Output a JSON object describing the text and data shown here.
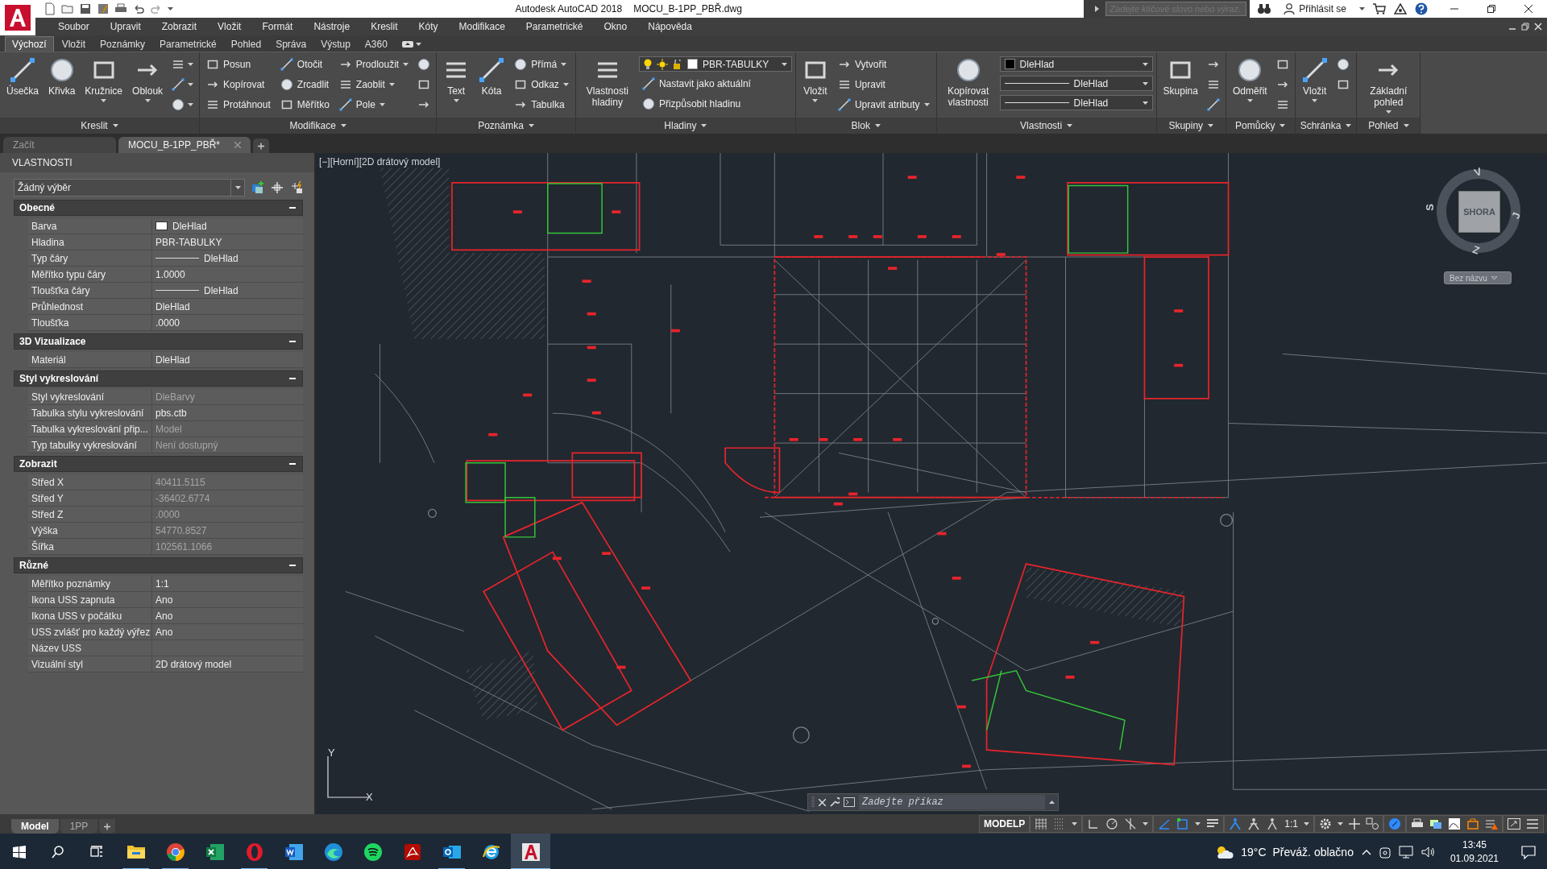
{
  "title_bar": {
    "app_title": "Autodesk AutoCAD 2018",
    "file_name": "MOCU_B-1PP_PBŘ.dwg",
    "search": {
      "placeholder": "Zadejte klíčové slovo nebo výraz."
    },
    "sign_in": "Přihlásit se"
  },
  "menu": [
    "Soubor",
    "Upravit",
    "Zobrazit",
    "Vložit",
    "Formát",
    "Nástroje",
    "Kreslit",
    "Kóty",
    "Modifikace",
    "Parametrické",
    "Okno",
    "Nápověda"
  ],
  "ribbon_tabs": [
    {
      "label": "Výchozí",
      "selected": true
    },
    {
      "label": "Vložit",
      "selected": false
    },
    {
      "label": "Poznámky",
      "selected": false
    },
    {
      "label": "Parametrické",
      "selected": false
    },
    {
      "label": "Pohled",
      "selected": false
    },
    {
      "label": "Správa",
      "selected": false
    },
    {
      "label": "Výstup",
      "selected": false
    },
    {
      "label": "A360",
      "selected": false
    }
  ],
  "ribbon_panels": [
    {
      "title": "Kreslit",
      "columns": [
        [
          {
            "kind": "large",
            "label": "Úsečka",
            "menu": false
          }
        ],
        [
          {
            "kind": "large",
            "label": "Křivka",
            "menu": false
          }
        ],
        [
          {
            "kind": "large",
            "label": "Kružnice",
            "menu": true
          }
        ],
        [
          {
            "kind": "large",
            "label": "Oblouk",
            "menu": true
          }
        ],
        [
          {
            "kind": "icon",
            "menu": true
          },
          {
            "kind": "icon",
            "menu": true
          },
          {
            "kind": "icon",
            "menu": true
          }
        ]
      ]
    },
    {
      "title": "Modifikace",
      "columns": [
        [
          {
            "kind": "small",
            "label": "Posun",
            "menu": false
          },
          {
            "kind": "small",
            "label": "Kopírovat",
            "menu": false
          },
          {
            "kind": "small",
            "label": "Protáhnout",
            "menu": false
          }
        ],
        [
          {
            "kind": "small",
            "label": "Otočit",
            "menu": false
          },
          {
            "kind": "small",
            "label": "Zrcadlit",
            "menu": false
          },
          {
            "kind": "small",
            "label": "Měřítko",
            "menu": false
          }
        ],
        [
          {
            "kind": "small",
            "label": "Prodloužit",
            "menu": true
          },
          {
            "kind": "small",
            "label": "Zaoblit",
            "menu": true
          },
          {
            "kind": "small",
            "label": "Pole",
            "menu": true
          }
        ],
        [
          {
            "kind": "icon",
            "menu": false
          },
          {
            "kind": "icon",
            "menu": false
          },
          {
            "kind": "icon",
            "menu": false
          }
        ]
      ]
    },
    {
      "title": "Poznámka",
      "columns": [
        [
          {
            "kind": "large",
            "label": "Text",
            "menu": true
          }
        ],
        [
          {
            "kind": "large",
            "label": "Kóta",
            "menu": false
          }
        ],
        [
          {
            "kind": "small",
            "label": "Přímá",
            "menu": true
          },
          {
            "kind": "small",
            "label": "Odkaz",
            "menu": true
          },
          {
            "kind": "small",
            "label": "Tabulka",
            "menu": false
          }
        ]
      ]
    },
    {
      "title": "Hladiny",
      "columns": [
        [
          {
            "kind": "large",
            "label": "Vlastnosti hladiny",
            "menu": false
          }
        ],
        [
          {
            "kind": "layer-dropdown",
            "value": "PBR-TABULKY"
          },
          {
            "kind": "small",
            "label": "Nastavit jako aktuální",
            "menu": false
          },
          {
            "kind": "small",
            "label": "Přizpůsobit hladinu",
            "menu": false
          }
        ]
      ]
    },
    {
      "title": "Blok",
      "columns": [
        [
          {
            "kind": "large",
            "label": "Vložit",
            "menu": true
          }
        ],
        [
          {
            "kind": "small",
            "label": "Vytvořit",
            "menu": false
          },
          {
            "kind": "small",
            "label": "Upravit",
            "menu": false
          },
          {
            "kind": "small",
            "label": "Upravit atributy",
            "menu": true
          }
        ]
      ]
    },
    {
      "title": "Vlastnosti",
      "columns": [
        [
          {
            "kind": "large",
            "label": "Kopírovat vlastnosti",
            "menu": false
          }
        ],
        [
          {
            "kind": "color-dropdown",
            "value": "DleHlad"
          },
          {
            "kind": "line-dropdown",
            "value": "DleHlad"
          },
          {
            "kind": "line-dropdown",
            "value": "DleHlad"
          }
        ]
      ]
    },
    {
      "title": "Skupiny",
      "columns": [
        [
          {
            "kind": "large",
            "label": "Skupina",
            "menu": false
          }
        ],
        [
          {
            "kind": "icon",
            "menu": false
          },
          {
            "kind": "icon",
            "menu": false
          },
          {
            "kind": "icon",
            "menu": false
          }
        ]
      ]
    },
    {
      "title": "Pomůcky",
      "columns": [
        [
          {
            "kind": "large",
            "label": "Odměřit",
            "menu": true
          }
        ],
        [
          {
            "kind": "icon",
            "menu": false
          },
          {
            "kind": "icon",
            "menu": false
          },
          {
            "kind": "icon",
            "menu": false
          }
        ]
      ]
    },
    {
      "title": "Schránka",
      "columns": [
        [
          {
            "kind": "large",
            "label": "Vložit",
            "menu": true
          }
        ],
        [
          {
            "kind": "icon",
            "menu": false
          },
          {
            "kind": "icon",
            "menu": false
          }
        ]
      ]
    },
    {
      "title": "Pohled",
      "columns": [
        [
          {
            "kind": "large",
            "label": "Základní pohled",
            "menu": true
          }
        ]
      ]
    }
  ],
  "document_tabs": [
    {
      "label": "Začít",
      "selected": false
    },
    {
      "label": "MOCU_B-1PP_PBŘ*",
      "selected": true
    }
  ],
  "properties": {
    "title": "VLASTNOSTI",
    "selection": "Žádný výběr",
    "sections": [
      {
        "title": "Obecné",
        "expanded": true,
        "rows": [
          {
            "name": "Barva",
            "value": "DleHlad",
            "kind": "color",
            "color": "#ffffff",
            "disabled": false
          },
          {
            "name": "Hladina",
            "value": "PBR-TABULKY",
            "kind": "text",
            "disabled": false
          },
          {
            "name": "Typ čáry",
            "value": "DleHlad",
            "kind": "line",
            "disabled": false
          },
          {
            "name": "Měřítko typu čáry",
            "value": "1.0000",
            "kind": "text",
            "disabled": false
          },
          {
            "name": "Tloušťka čáry",
            "value": "DleHlad",
            "kind": "line",
            "disabled": false
          },
          {
            "name": "Průhlednost",
            "value": "DleHlad",
            "kind": "text",
            "disabled": false
          },
          {
            "name": "Tloušťka",
            "value": ".0000",
            "kind": "text",
            "disabled": false
          }
        ]
      },
      {
        "title": "3D Vizualizace",
        "expanded": true,
        "rows": [
          {
            "name": "Materiál",
            "value": "DleHlad",
            "kind": "text",
            "disabled": false
          }
        ]
      },
      {
        "title": "Styl vykreslování",
        "expanded": true,
        "rows": [
          {
            "name": "Styl vykreslování",
            "value": "DleBarvy",
            "kind": "text",
            "disabled": true
          },
          {
            "name": "Tabulka stylu vykreslování",
            "value": "pbs.ctb",
            "kind": "text",
            "disabled": false
          },
          {
            "name": "Tabulka vykreslování přip...",
            "value": "Model",
            "kind": "text",
            "disabled": true
          },
          {
            "name": "Typ tabulky vykreslování",
            "value": "Není dostupný",
            "kind": "text",
            "disabled": true
          }
        ]
      },
      {
        "title": "Zobrazit",
        "expanded": true,
        "rows": [
          {
            "name": "Střed X",
            "value": "40411.5115",
            "kind": "text",
            "disabled": true
          },
          {
            "name": "Střed Y",
            "value": "-36402.6774",
            "kind": "text",
            "disabled": true
          },
          {
            "name": "Střed Z",
            "value": ".0000",
            "kind": "text",
            "disabled": true
          },
          {
            "name": "Výška",
            "value": "54770.8527",
            "kind": "text",
            "disabled": true
          },
          {
            "name": "Šířka",
            "value": "102561.1066",
            "kind": "text",
            "disabled": true
          }
        ]
      },
      {
        "title": "Různé",
        "expanded": true,
        "rows": [
          {
            "name": "Měřítko poznámky",
            "value": "1:1",
            "kind": "text",
            "disabled": false
          },
          {
            "name": "Ikona USS zapnuta",
            "value": "Ano",
            "kind": "text",
            "disabled": false
          },
          {
            "name": "Ikona USS v počátku",
            "value": "Ano",
            "kind": "text",
            "disabled": false
          },
          {
            "name": "USS zvlášť pro každý výřez",
            "value": "Ano",
            "kind": "text",
            "disabled": false
          },
          {
            "name": "Název USS",
            "kind": "text",
            "disabled": false
          },
          {
            "name": "Vizuální styl",
            "value": "2D drátový model",
            "kind": "text",
            "disabled": false
          }
        ]
      }
    ]
  },
  "viewport": {
    "label": "[−][Horní][2D drátový model]",
    "viewcube": {
      "face": "SHORA",
      "compass": [
        "V",
        "J",
        "Z",
        "S"
      ],
      "named_view": "Bez názvu"
    },
    "ucs": {
      "y": "Y",
      "x": "X"
    },
    "command_line": {
      "placeholder": "Zadejte příkaz"
    }
  },
  "layout_tabs": [
    {
      "label": "Model",
      "selected": true
    },
    {
      "label": "1PP",
      "selected": false
    }
  ],
  "status_bar": {
    "space": "MODELP",
    "scale": "1:1",
    "toggles": [
      {
        "on": false
      },
      {
        "on": false
      },
      {
        "on": false
      },
      {
        "on": false
      },
      {
        "on": false
      },
      {
        "on": true
      },
      {
        "on": true
      },
      {
        "on": false
      },
      {
        "on": true
      },
      {
        "on": false
      },
      {
        "on": false
      },
      {
        "on": true
      }
    ]
  },
  "taskbar": {
    "apps": [
      {
        "running": true,
        "active": false
      },
      {
        "running": true,
        "active": false
      },
      {
        "running": false,
        "active": false
      },
      {
        "running": true,
        "active": false
      },
      {
        "running": false,
        "active": false
      },
      {
        "running": false,
        "active": false
      },
      {
        "running": false,
        "active": false
      },
      {
        "running": false,
        "active": false
      },
      {
        "running": true,
        "active": false
      },
      {
        "running": false,
        "active": false
      },
      {
        "running": true,
        "active": true
      }
    ],
    "weather": {
      "temperature": "19°C",
      "condition": "Převáž. oblačno"
    },
    "time": "13:45",
    "date": "01.09.2021"
  }
}
